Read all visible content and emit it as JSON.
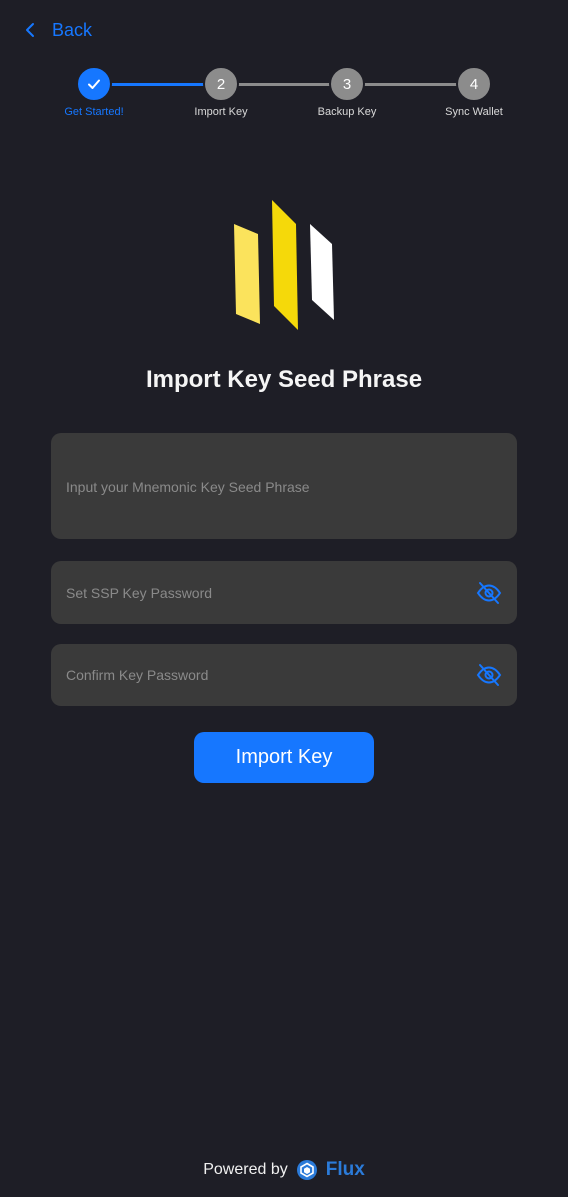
{
  "nav": {
    "back_label": "Back"
  },
  "stepper": {
    "steps": [
      {
        "number": "1",
        "label": "Get Started!",
        "state": "done"
      },
      {
        "number": "2",
        "label": "Import Key",
        "state": "pending"
      },
      {
        "number": "3",
        "label": "Backup Key",
        "state": "pending"
      },
      {
        "number": "4",
        "label": "Sync Wallet",
        "state": "pending"
      }
    ]
  },
  "logo": {
    "icon": "ssp-wallet-logo-icon"
  },
  "page": {
    "title": "Import Key Seed Phrase"
  },
  "form": {
    "seed_placeholder": "Input your Mnemonic Key Seed Phrase",
    "password_placeholder": "Set SSP Key Password",
    "confirm_placeholder": "Confirm Key Password",
    "toggle_icon": "eye-invisible-icon",
    "submit_label": "Import Key"
  },
  "footer": {
    "powered_by": "Powered by",
    "brand": "Flux",
    "brand_icon": "flux-logo-icon"
  },
  "colors": {
    "background": "#1e1e26",
    "accent": "#1677ff",
    "input_bg": "#3a3a3a",
    "logo_yellow": "#f5d90a",
    "logo_light_yellow": "#fbe35c"
  }
}
